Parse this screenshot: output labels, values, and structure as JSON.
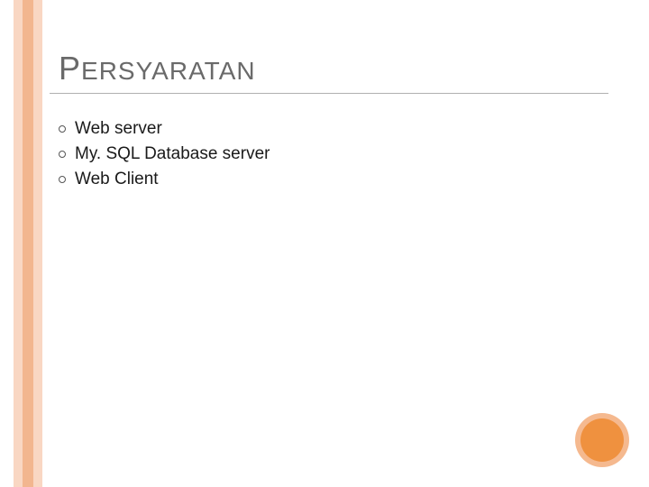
{
  "slide": {
    "title_first_letter": "P",
    "title_rest": "ERSYARATAN",
    "bullets": {
      "item1": "Web server",
      "item2": "My. SQL Database server",
      "item3": "Web Client"
    }
  }
}
